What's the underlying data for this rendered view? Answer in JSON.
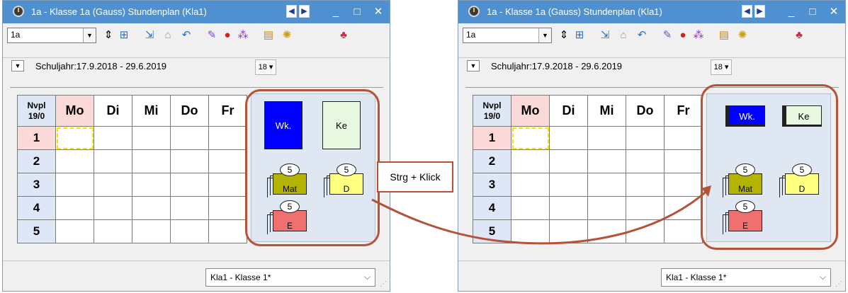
{
  "window": {
    "title": "1a - Klasse 1a (Gauss)  Stundenplan  (Kla1)",
    "controls": {
      "prev": "◀",
      "next": "▶",
      "minimize": "_",
      "maximize": "□",
      "close": "✕"
    }
  },
  "toolbar": {
    "class_value": "1a",
    "icons": [
      "spinner-icon",
      "grid-icon",
      "export-icon",
      "lock-icon",
      "undo-icon",
      "edit-icon",
      "search-icon",
      "network-icon",
      "doc-icon",
      "settings-icon",
      "users-icon"
    ]
  },
  "subbar": {
    "schuljahr": "Schuljahr:17.9.2018 - 29.6.2019",
    "calendar_label": "18"
  },
  "grid": {
    "corner_line1": "Nvpl",
    "corner_line2": "19/0",
    "days": [
      "Mo",
      "Di",
      "Mi",
      "Do",
      "Fr"
    ],
    "periods": [
      "1",
      "2",
      "3",
      "4",
      "5"
    ]
  },
  "pool": {
    "cards": [
      {
        "label": "Wk.",
        "color": "#0000ff",
        "text_color": "#ffffff"
      },
      {
        "label": "Ke",
        "color": "#e8f8e0",
        "text_color": "#000000"
      }
    ],
    "stacks": [
      {
        "label": "Mat",
        "count": "5",
        "color": "#b3b300"
      },
      {
        "label": "D",
        "count": "5",
        "color": "#ffff80"
      },
      {
        "label": "E",
        "count": "5",
        "color": "#f07070"
      }
    ]
  },
  "status": {
    "select_value": "Kla1 - Klasse 1*"
  },
  "annotation": {
    "label": "Strg + Klick",
    "frame_color": "#b5523a"
  }
}
